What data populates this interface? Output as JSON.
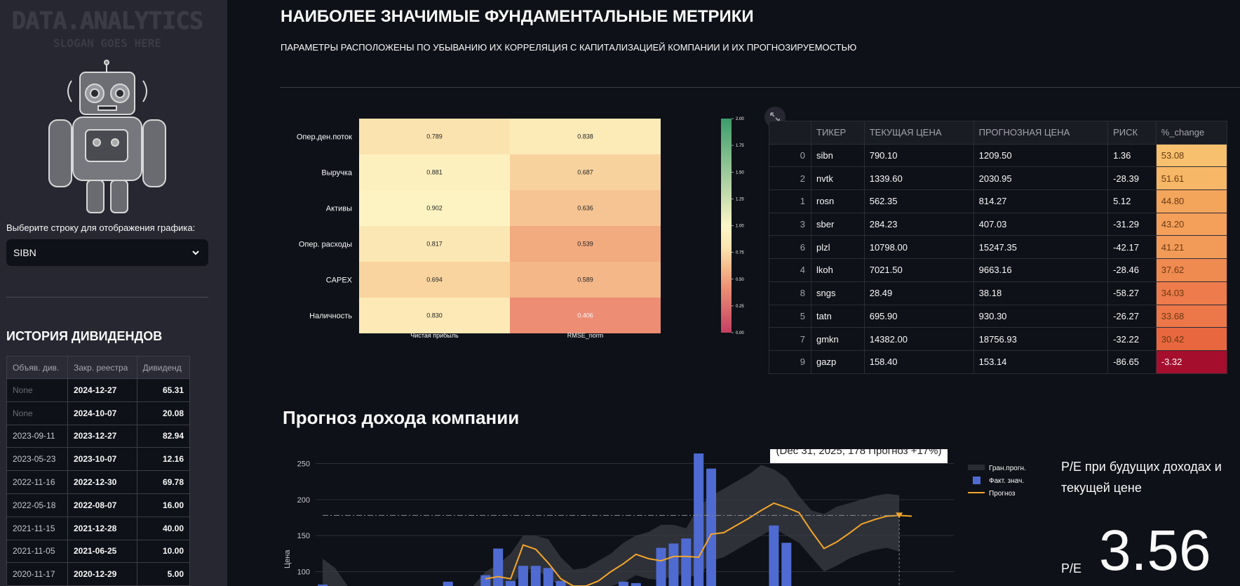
{
  "sidebar": {
    "logo_title": "DATA.ANALYTICS",
    "logo_slogan": "SLOGAN GOES HERE",
    "select_label": "Выберите строку для отображения графика:",
    "select_value": "SIBN",
    "dividends_title": "ИСТОРИЯ ДИВИДЕНДОВ",
    "dividends_headers": [
      "Объяв. див.",
      "Закр. реестра",
      "Дивиденд"
    ],
    "dividends_rows": [
      [
        "None",
        "2024-12-27",
        "65.31"
      ],
      [
        "None",
        "2024-10-07",
        "20.08"
      ],
      [
        "2023-09-11",
        "2023-12-27",
        "82.94"
      ],
      [
        "2023-05-23",
        "2023-10-07",
        "12.16"
      ],
      [
        "2022-11-16",
        "2022-12-30",
        "69.78"
      ],
      [
        "2022-05-18",
        "2022-08-07",
        "16.00"
      ],
      [
        "2021-11-15",
        "2021-12-28",
        "40.00"
      ],
      [
        "2021-11-05",
        "2021-06-25",
        "10.00"
      ],
      [
        "2020-11-17",
        "2020-12-29",
        "5.00"
      ]
    ]
  },
  "main": {
    "title": "НАИБОЛЕЕ ЗНАЧИМЫЕ ФУНДАМЕНТАЛЬНЫЕ МЕТРИКИ",
    "subtitle": "ПАРАМЕТРЫ РАСПОЛОЖЕНЫ ПО УБЫВАНИЮ ИХ КОРРЕЛЯЦИЯ С КАПИТАЛИЗАЦИЕЙ КОМПАНИИ И ИХ ПРОГНОЗИРУЕМОСТЬЮ"
  },
  "ticker_table": {
    "headers": [
      "",
      "ТИКЕР",
      "ТЕКУЩАЯ ЦЕНА",
      "ПРОГНОЗНАЯ ЦЕНА",
      "РИСК",
      "%_change"
    ],
    "rows": [
      [
        "0",
        "sibn",
        "790.10",
        "1209.50",
        "1.36",
        "53.08"
      ],
      [
        "2",
        "nvtk",
        "1339.60",
        "2030.95",
        "-28.39",
        "51.61"
      ],
      [
        "1",
        "rosn",
        "562.35",
        "814.27",
        "5.12",
        "44.80"
      ],
      [
        "3",
        "sber",
        "284.23",
        "407.03",
        "-31.29",
        "43.20"
      ],
      [
        "6",
        "plzl",
        "10798.00",
        "15247.35",
        "-42.17",
        "41.21"
      ],
      [
        "4",
        "lkoh",
        "7021.50",
        "9663.16",
        "-28.46",
        "37.62"
      ],
      [
        "8",
        "sngs",
        "28.49",
        "38.18",
        "-58.27",
        "34.03"
      ],
      [
        "5",
        "tatn",
        "695.90",
        "930.30",
        "-26.27",
        "33.68"
      ],
      [
        "7",
        "gmkn",
        "14382.00",
        "18756.93",
        "-32.22",
        "30.42"
      ],
      [
        "9",
        "gazp",
        "158.40",
        "153.14",
        "-86.65",
        "-3.32"
      ]
    ],
    "change_colors": [
      "#f6c06e",
      "#f6b766",
      "#f4a55c",
      "#f4a05a",
      "#f29b58",
      "#ef8a50",
      "#ed7b4b",
      "#ec7749",
      "#e8673f",
      "#a50f2d"
    ]
  },
  "forecast": {
    "title": "Прогноз дохода компании",
    "tooltip": "(Dec 31, 2025, 178 Прогноз +17%)",
    "pe_label": "P/E при будущих доходах и текущей цене",
    "pe_small": "P/E",
    "pe_value": "3.56"
  },
  "chart_data": [
    {
      "type": "heatmap",
      "rows": [
        "Опер.ден.поток",
        "Выручка",
        "Активы",
        "Опер. расходы",
        "CAPEX",
        "Наличность"
      ],
      "columns": [
        "Чистая прибыль",
        "RMSE_norm"
      ],
      "values": [
        [
          0.789,
          0.838
        ],
        [
          0.881,
          0.687
        ],
        [
          0.902,
          0.636
        ],
        [
          0.817,
          0.539
        ],
        [
          0.694,
          0.589
        ],
        [
          0.83,
          0.406
        ]
      ],
      "colorbar_ticks": [
        "2.00",
        "1.75",
        "1.50",
        "1.25",
        "1.00",
        "0.75",
        "0.50",
        "0.25",
        "0.00"
      ],
      "vmin": 0,
      "vmax": 2
    },
    {
      "type": "bar",
      "ylabel": "Цена",
      "y_ticks": [
        100,
        150,
        200,
        250
      ],
      "ylim": [
        80,
        270
      ],
      "legend": [
        "Гран.прогн.",
        "Факт. знач.",
        "Прогноз"
      ],
      "bar_values": [
        82,
        null,
        null,
        null,
        null,
        null,
        null,
        null,
        null,
        null,
        86,
        null,
        null,
        95,
        132,
        87,
        108,
        108,
        105,
        87,
        null,
        null,
        null,
        null,
        86,
        84,
        null,
        133,
        139,
        146,
        264,
        243,
        null,
        null,
        null,
        null,
        164,
        140,
        null,
        null,
        null,
        null,
        null,
        null,
        null,
        null
      ],
      "forecast_values": [
        null,
        null,
        null,
        null,
        null,
        null,
        null,
        null,
        null,
        null,
        null,
        null,
        null,
        90,
        93,
        90,
        137,
        131,
        112,
        90,
        80,
        80,
        87,
        100,
        111,
        124,
        118,
        115,
        121,
        121,
        120,
        152,
        154,
        164,
        174,
        185,
        195,
        189,
        182,
        156,
        132,
        141,
        153,
        166,
        172,
        177,
        178,
        177
      ],
      "band_high": [
        118,
        105,
        80,
        80,
        80,
        80,
        80,
        80,
        80,
        80,
        80,
        80,
        80,
        100,
        110,
        125,
        150,
        150,
        145,
        120,
        103,
        105,
        115,
        125,
        140,
        150,
        155,
        165,
        165,
        160,
        190,
        205,
        215,
        225,
        235,
        248,
        242,
        230,
        205,
        185,
        180,
        190,
        195,
        200,
        205,
        208,
        206
      ],
      "band_low": [
        80,
        80,
        80,
        80,
        80,
        80,
        80,
        80,
        80,
        80,
        80,
        80,
        80,
        80,
        80,
        80,
        100,
        105,
        90,
        80,
        80,
        80,
        80,
        80,
        85,
        95,
        90,
        88,
        95,
        95,
        92,
        115,
        120,
        130,
        140,
        150,
        160,
        150,
        140,
        120,
        100,
        108,
        118,
        125,
        130,
        133,
        128
      ],
      "ref_line": 178
    }
  ]
}
